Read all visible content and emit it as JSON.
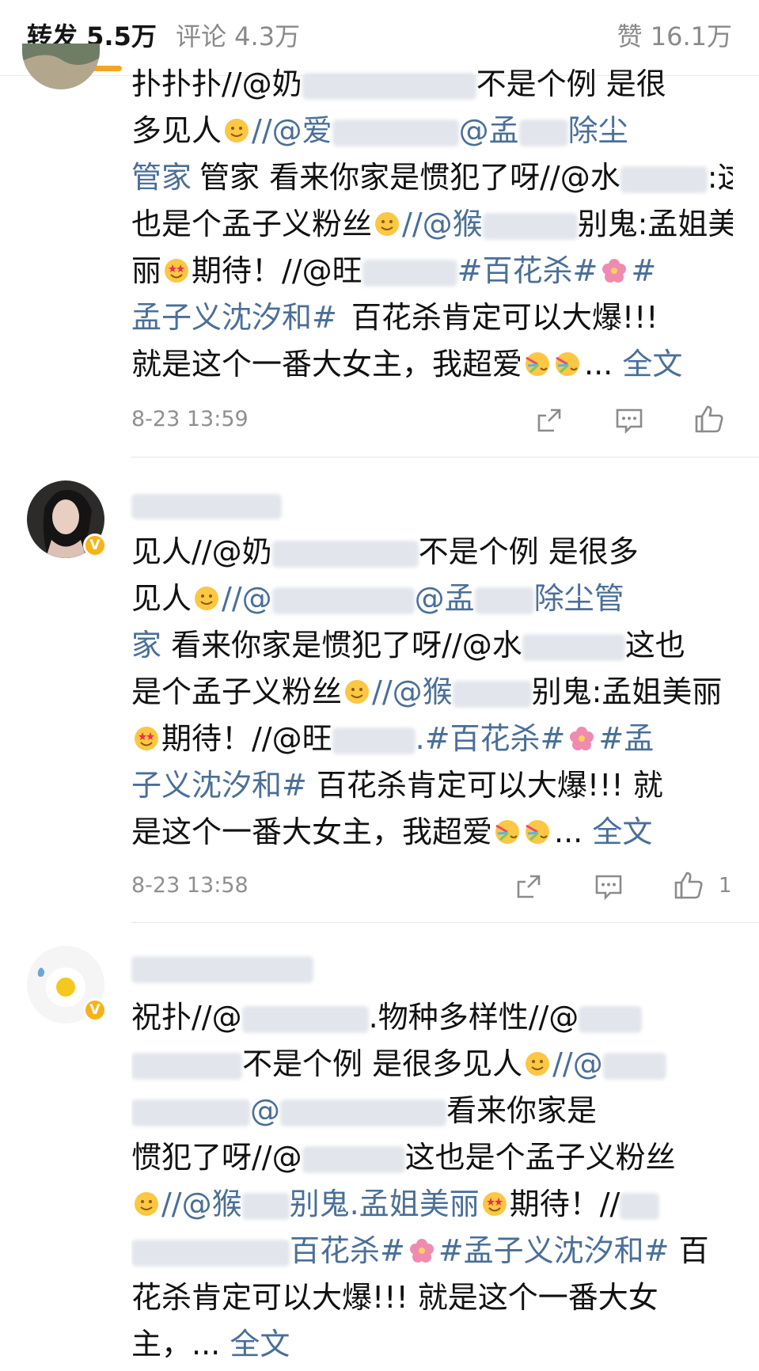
{
  "tabs": {
    "repost": "转发 5.5万",
    "comment": "评论 4.3万",
    "like": "赞 16.1万"
  },
  "comments": [
    {
      "username": "",
      "lines": [
        "扑扑扑//@奶",
        "不是个例 是很",
        "多见人",
        "//@爱",
        "@孟",
        "除尘",
        "管家 看来你家是惯犯了呀//@水",
        "也是个孟子义粉丝",
        "//@猴",
        "别鬼:孟姐美",
        "丽",
        "期待！//@旺",
        "#百花杀#",
        "#",
        "孟子义沈汐和#",
        "百花杀肯定可以大爆!!!",
        "就是这个一番大女主，我超爱",
        "... ",
        "全文"
      ],
      "timestamp": "8-23 13:59",
      "likes": ""
    },
    {
      "username": "",
      "lines": [
        "见人//@奶",
        "不是个例 是很多",
        "见人",
        "//@",
        "@孟",
        "除尘管",
        "家",
        " 看来你家是惯犯了呀//@水",
        "这也",
        "是个孟子义粉丝",
        "//@猴",
        "别鬼:孟姐美丽",
        "期待！//@旺",
        ".#百花杀#",
        "#孟",
        "子义沈汐和#",
        " 百花杀肯定可以大爆!!!  就",
        "是这个一番大女主，我超爱",
        "... ",
        "全文"
      ],
      "timestamp": "8-23 13:58",
      "likes": "1"
    },
    {
      "username": "",
      "lines": [
        "祝扑//@",
        ".物种多样性//@",
        "不是个例 是很多见人",
        "//@",
        "@",
        "看来你家是",
        "惯犯了呀//@",
        "这也是个孟子义粉丝",
        "//@猴",
        "别鬼.孟姐美丽",
        "期待！//",
        "百花杀#",
        "#孟子义沈汐和#",
        " 百",
        "花杀肯定可以大爆!!!  就是这个一番大女",
        "主，... ",
        "全文"
      ]
    }
  ],
  "icons": {
    "repost": "repost-icon",
    "comment": "comment-icon",
    "like": "like-icon",
    "verified": "verified-badge",
    "emoji_smile": "smile-emoji",
    "emoji_star": "star-eyes-emoji",
    "emoji_party": "party-emoji",
    "flower": "flower-emoji"
  },
  "colors": {
    "accent": "#f4a623",
    "link": "#4a6f98",
    "text": "#111111",
    "muted": "#8a8a8a"
  }
}
